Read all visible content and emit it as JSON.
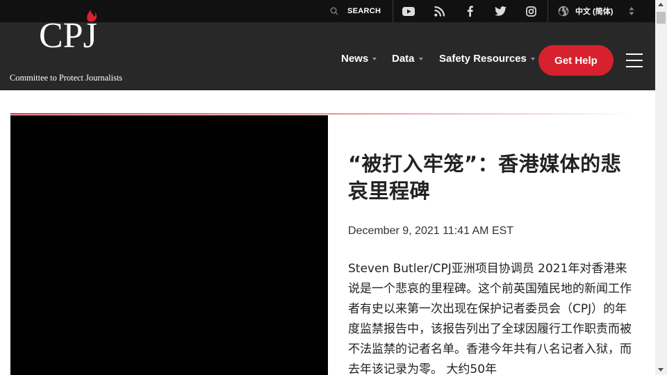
{
  "topbar": {
    "search_label": "SEARCH",
    "social_icons": [
      "youtube-icon",
      "rss-icon",
      "facebook-icon",
      "twitter-icon",
      "instagram-icon"
    ],
    "language_label": "中文 (简体)"
  },
  "logo": {
    "mark": "CPJ",
    "name": "Committee to Protect Journalists"
  },
  "nav": {
    "items": [
      {
        "label": "News"
      },
      {
        "label": "Data"
      },
      {
        "label": "Safety Resources"
      }
    ],
    "get_help_label": "Get Help"
  },
  "article": {
    "title": "“被打入牢笼”：香港媒体的悲哀里程碑",
    "date": "December 9, 2021 11:41 AM EST",
    "body": "Steven Butler/CPJ亚洲项目协调员 2021年对香港来说是一个悲哀的里程碑。这个前英国殖民地的新闻工作者有史以来第一次出现在保护记者委员会（CPJ）的年度监禁报告中，该报告列出了全球因履行工作职责而被不法监禁的记者名单。香港今年共有八名记者入狱，而去年该记录为零。 大约50年"
  },
  "colors": {
    "header_bg": "#282828",
    "topbar_bg": "#111111",
    "accent_red": "#d8212e"
  }
}
